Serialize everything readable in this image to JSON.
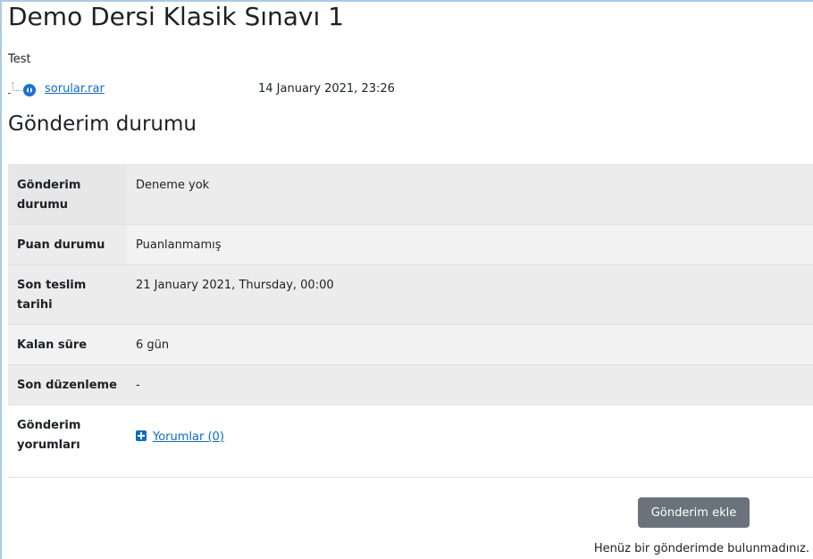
{
  "page": {
    "title": "Demo Dersi Klasik Sınavı 1",
    "intro": "Test"
  },
  "attachment": {
    "filename": "sorular.rar",
    "date": "14 January 2021, 23:26",
    "icon": "file-icon"
  },
  "submission_status": {
    "heading": "Gönderim durumu",
    "rows": [
      {
        "label": "Gönderim durumu",
        "value": "Deneme yok"
      },
      {
        "label": "Puan durumu",
        "value": "Puanlanmamış"
      },
      {
        "label": "Son teslim tarihi",
        "value": "21 January 2021, Thursday, 00:00"
      },
      {
        "label": "Kalan süre",
        "value": "6 gün"
      },
      {
        "label": "Son düzenleme",
        "value": "-"
      },
      {
        "label": "Gönderim yorumları",
        "value": "Yorumlar (0)"
      }
    ]
  },
  "actions": {
    "add_submission": "Gönderim ekle",
    "note": "Henüz bir gönderimde bulunmadınız."
  },
  "colors": {
    "link": "#0f6cbf",
    "button": "#6a737b",
    "row_shade": "#ececec"
  }
}
